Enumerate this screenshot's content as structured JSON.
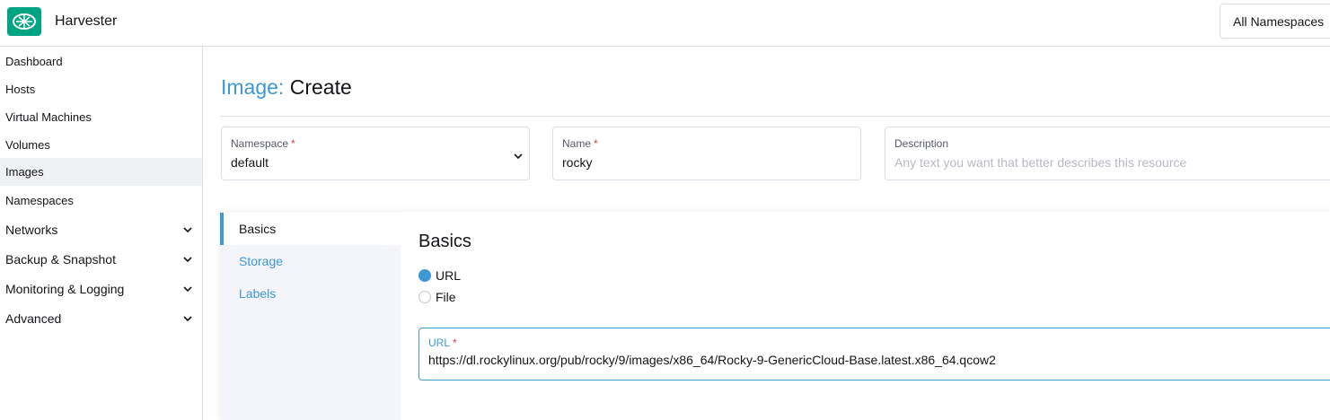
{
  "header": {
    "app_title": "Harvester",
    "namespace_filter": "All Namespaces",
    "logo_icon": "harvester-logo-icon"
  },
  "sidebar": {
    "items": [
      {
        "label": "Dashboard"
      },
      {
        "label": "Hosts"
      },
      {
        "label": "Virtual Machines"
      },
      {
        "label": "Volumes"
      },
      {
        "label": "Images",
        "active": true
      },
      {
        "label": "Namespaces"
      },
      {
        "label": "Networks",
        "expandable": true
      },
      {
        "label": "Backup & Snapshot",
        "expandable": true
      },
      {
        "label": "Monitoring & Logging",
        "expandable": true
      },
      {
        "label": "Advanced",
        "expandable": true
      }
    ]
  },
  "page": {
    "title_resource": "Image:",
    "title_action": "Create"
  },
  "form": {
    "namespace": {
      "label": "Namespace",
      "required_mark": "*",
      "value": "default"
    },
    "name": {
      "label": "Name",
      "required_mark": "*",
      "value": "rocky"
    },
    "description": {
      "label": "Description",
      "placeholder": "Any text you want that better describes this resource"
    }
  },
  "tabs": [
    {
      "label": "Basics",
      "active": true
    },
    {
      "label": "Storage"
    },
    {
      "label": "Labels"
    }
  ],
  "basics": {
    "section_title": "Basics",
    "source_options": [
      {
        "label": "URL",
        "checked": true
      },
      {
        "label": "File",
        "checked": false
      }
    ],
    "url_field": {
      "label": "URL",
      "required_mark": "*",
      "value": "https://dl.rockylinux.org/pub/rocky/9/images/x86_64/Rocky-9-GenericCloud-Base.latest.x86_64.qcow2"
    }
  },
  "colors": {
    "brand": "#00a483",
    "accent": "#3d98d3",
    "required": "#d13f3f"
  }
}
